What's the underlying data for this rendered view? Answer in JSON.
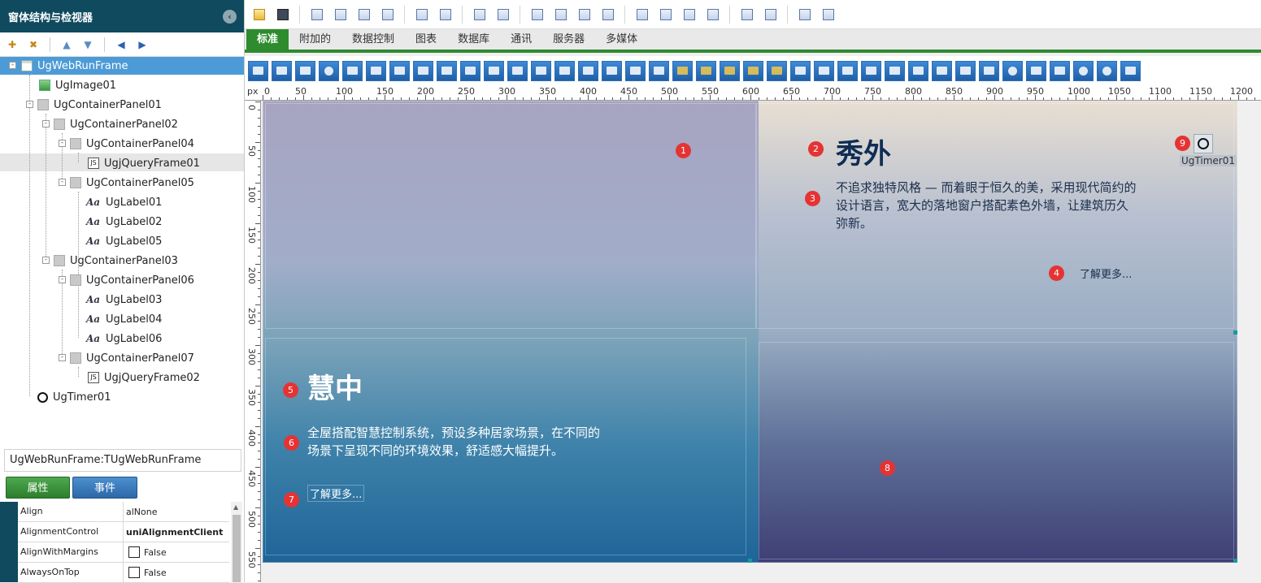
{
  "left_panel": {
    "title": "窗体结构与检视器",
    "tree": [
      {
        "label": "UgWebRunFrame",
        "icon": "frame-icon"
      },
      {
        "label": "UgImage01",
        "icon": "image-icon"
      },
      {
        "label": "UgContainerPanel01",
        "icon": "panel-icon"
      },
      {
        "label": "UgContainerPanel02",
        "icon": "panel-icon"
      },
      {
        "label": "UgContainerPanel04",
        "icon": "panel-icon"
      },
      {
        "label": "UgjQueryFrame01",
        "icon": "js-icon"
      },
      {
        "label": "UgContainerPanel05",
        "icon": "panel-icon"
      },
      {
        "label": "UgLabel01",
        "icon": "label-icon"
      },
      {
        "label": "UgLabel02",
        "icon": "label-icon"
      },
      {
        "label": "UgLabel05",
        "icon": "label-icon"
      },
      {
        "label": "UgContainerPanel03",
        "icon": "panel-icon"
      },
      {
        "label": "UgContainerPanel06",
        "icon": "panel-icon"
      },
      {
        "label": "UgLabel03",
        "icon": "label-icon"
      },
      {
        "label": "UgLabel04",
        "icon": "label-icon"
      },
      {
        "label": "UgLabel06",
        "icon": "label-icon"
      },
      {
        "label": "UgContainerPanel07",
        "icon": "panel-icon"
      },
      {
        "label": "UgjQueryFrame02",
        "icon": "js-icon"
      },
      {
        "label": "UgTimer01",
        "icon": "timer-icon"
      }
    ],
    "object_name": "UgWebRunFrame:TUgWebRunFrame",
    "tabs": {
      "properties": "属性",
      "events": "事件"
    },
    "props": [
      {
        "name": "Align",
        "value": "alNone"
      },
      {
        "name": "AlignmentControl",
        "value": "uniAlignmentClient"
      },
      {
        "name": "AlignWithMargins",
        "value": "False"
      },
      {
        "name": "AlwaysOnTop",
        "value": "False"
      }
    ]
  },
  "tabbar": {
    "tabs": [
      "标准",
      "附加的",
      "数据控制",
      "图表",
      "数据库",
      "通讯",
      "服务器",
      "多媒体"
    ]
  },
  "ruler": {
    "unit": "px",
    "top_labels": [
      "0",
      "50",
      "100",
      "150",
      "200",
      "250",
      "300",
      "350",
      "400",
      "450",
      "500",
      "550",
      "600",
      "650",
      "700",
      "750",
      "800",
      "850",
      "900",
      "950",
      "1000",
      "1050",
      "1100",
      "1150",
      "1200"
    ],
    "left_labels": [
      "0",
      "50",
      "100",
      "150",
      "200",
      "250",
      "300",
      "350",
      "400",
      "450",
      "500",
      "550"
    ]
  },
  "canvas": {
    "badges": [
      "1",
      "2",
      "3",
      "4",
      "5",
      "6",
      "7",
      "8",
      "9"
    ],
    "top_title": "秀外",
    "top_text": "不追求独特风格 — 而着眼于恒久的美，采用现代简约的设计语言，宽大的落地窗户搭配素色外墙，让建筑历久弥新。",
    "top_link": "了解更多...",
    "bottom_title": "慧中",
    "bottom_text": "全屋搭配智慧控制系统，预设多种居家场景，在不同的场景下呈现不同的环境效果，舒适感大幅提升。",
    "bottom_link": "了解更多...",
    "timer_label": "UgTimer01"
  }
}
